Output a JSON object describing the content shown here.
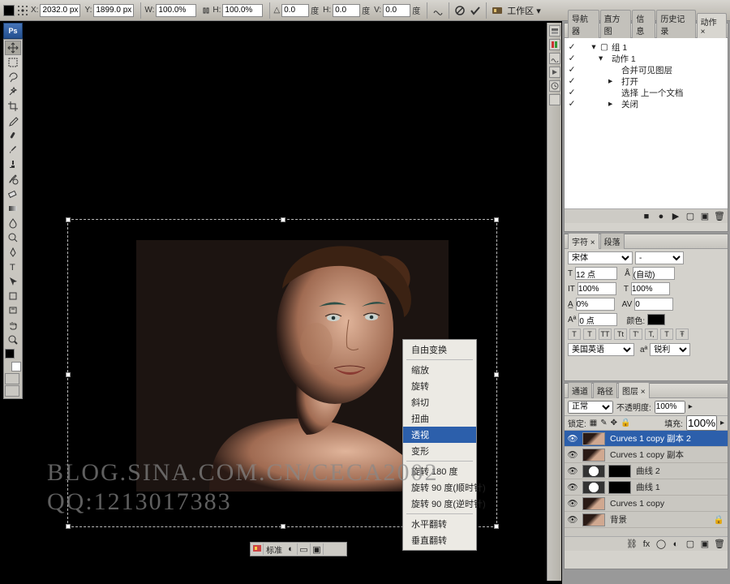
{
  "options": {
    "x_label": "X:",
    "x_value": "2032.0 px",
    "y_label": "Y:",
    "y_value": "1899.0 px",
    "w_label": "W:",
    "w_value": "100.0%",
    "h_label": "H:",
    "h_value": "100.0%",
    "angle_label": "△",
    "angle_value": "0.0",
    "angle_unit": "度",
    "skewH_label": "H:",
    "skewH_value": "0.0",
    "skewH_unit": "度",
    "skewV_label": "V:",
    "skewV_value": "0.0",
    "skewV_unit": "度",
    "workspace": "工作区 ▾"
  },
  "history_panel": {
    "tabs": [
      "导航器",
      "直方图",
      "信息",
      "历史记录",
      "动作"
    ],
    "active_tab": 4,
    "tree": [
      {
        "indent": 0,
        "checked": true,
        "twisty": "▾",
        "icon": "▢",
        "name": "组 1"
      },
      {
        "indent": 1,
        "checked": true,
        "twisty": "▾",
        "icon": "",
        "name": "动作 1"
      },
      {
        "indent": 2,
        "checked": true,
        "twisty": "",
        "icon": "",
        "name": "合并可见图层"
      },
      {
        "indent": 2,
        "checked": true,
        "twisty": "▸",
        "icon": "",
        "name": "打开"
      },
      {
        "indent": 2,
        "checked": true,
        "twisty": "",
        "icon": "",
        "name": "选择 上一个文档"
      },
      {
        "indent": 2,
        "checked": true,
        "twisty": "▸",
        "icon": "",
        "name": "关闭"
      }
    ]
  },
  "char_panel": {
    "tabs": [
      "字符",
      "段落"
    ],
    "active_tab": 0,
    "font_family": "宋体",
    "font_style": "-",
    "size_label": "T",
    "size_value": "12 点",
    "leading_label": "A",
    "leading_value": "(自动)",
    "vscale_label": "IT",
    "vscale_value": "100%",
    "hscale_label": "T",
    "hscale_value": "100%",
    "tracking_label": "VA",
    "tracking_value": "0",
    "kerning_value": "0%",
    "baseline_label": "Aª",
    "baseline_value": "0 点",
    "color_label": "颜色:",
    "lang": "美国英语",
    "aa_label": "aª",
    "aa_value": "锐利",
    "styles": [
      "T",
      "T",
      "TT",
      "Tt",
      "T'",
      "T,",
      "T",
      "Ŧ"
    ]
  },
  "layers_panel": {
    "tabs": [
      "通道",
      "路径",
      "图层"
    ],
    "active_tab": 2,
    "blend": "正常",
    "opacity_label": "不透明度:",
    "opacity": "100%",
    "lock_label": "锁定:",
    "fill_label": "填充:",
    "fill": "100%",
    "layers": [
      {
        "v": true,
        "thumb": "photo",
        "name": "Curves 1 copy 副本 2",
        "sel": true
      },
      {
        "v": true,
        "thumb": "photo",
        "name": "Curves 1 copy 副本"
      },
      {
        "v": true,
        "thumb": "adj",
        "mask": true,
        "name": "曲线 2"
      },
      {
        "v": true,
        "thumb": "adj",
        "mask": true,
        "name": "曲线 1"
      },
      {
        "v": true,
        "thumb": "photo",
        "name": "Curves 1 copy"
      },
      {
        "v": true,
        "thumb": "photo",
        "name": "背景",
        "locked": true
      }
    ]
  },
  "context_menu": {
    "items": [
      {
        "label": "自由变换"
      },
      {
        "sep": true
      },
      {
        "label": "缩放"
      },
      {
        "label": "旋转"
      },
      {
        "label": "斜切"
      },
      {
        "label": "扭曲"
      },
      {
        "label": "透视",
        "sel": true
      },
      {
        "label": "变形"
      },
      {
        "sep": true
      },
      {
        "label": "旋转 180 度"
      },
      {
        "label": "旋转 90 度(顺时针)"
      },
      {
        "label": "旋转 90 度(逆时针)"
      },
      {
        "sep": true
      },
      {
        "label": "水平翻转"
      },
      {
        "label": "垂直翻转"
      }
    ]
  },
  "status": {
    "mode": "标准"
  },
  "watermark": {
    "line1": "BLOG.SINA.COM.CN/CECA2002",
    "line2": "QQ:1213017383"
  }
}
